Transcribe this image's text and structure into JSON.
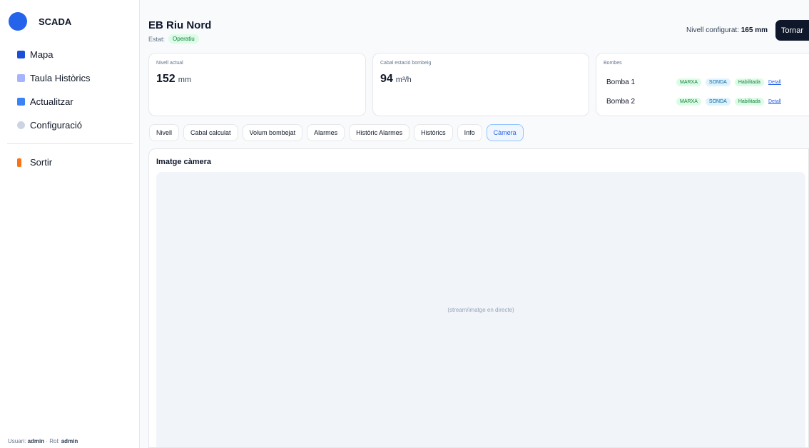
{
  "sidebar": {
    "brand": "SCADA",
    "items": [
      {
        "label": "Mapa",
        "icon": "map-icon",
        "color": "#1d4ed8"
      },
      {
        "label": "Taula Històrics",
        "icon": "chart-icon",
        "color": "#a5b4fc"
      },
      {
        "label": "Actualitzar",
        "icon": "refresh-icon",
        "color": "#3b82f6"
      },
      {
        "label": "Configuració",
        "icon": "gear-icon",
        "color": "#cbd5e1"
      }
    ],
    "logout": {
      "label": "Sortir",
      "icon": "exit-icon",
      "color": "#f97316"
    },
    "user_prefix": "Usuari:",
    "user": "admin",
    "role_prefix": "· Rol:",
    "role": "admin"
  },
  "header": {
    "title": "EB Riu Nord",
    "estat_label": "Estat:",
    "estat_value": "Operatiu",
    "nivell_conf_label": "Nivell configurat:",
    "nivell_conf_value": "165 mm",
    "tornar_label": "Tornar"
  },
  "cards": {
    "nivell": {
      "label": "Nivell actual",
      "value": "152",
      "unit": "mm"
    },
    "cabal": {
      "label": "Cabal estació bombeig",
      "value": "94",
      "unit": "m³/h"
    },
    "bombes": {
      "label": "Bombes",
      "pumps": [
        {
          "name": "Bomba 1",
          "marxa": "MARXA",
          "sonda": "SONDA",
          "estat": "Habilitada",
          "detall": "Detall"
        },
        {
          "name": "Bomba 2",
          "marxa": "MARXA",
          "sonda": "SONDA",
          "estat": "Habilitada",
          "detall": "Detall"
        }
      ]
    }
  },
  "tabs": [
    {
      "label": "Nivell"
    },
    {
      "label": "Cabal calculat"
    },
    {
      "label": "Volum bombejat"
    },
    {
      "label": "Alarmes"
    },
    {
      "label": "Històric Alarmes"
    },
    {
      "label": "Històrics"
    },
    {
      "label": "Info"
    },
    {
      "label": "Càmera"
    }
  ],
  "active_tab": "Càmera",
  "camera": {
    "title": "Imatge càmera",
    "placeholder": "(stream/imatge en directe)"
  }
}
